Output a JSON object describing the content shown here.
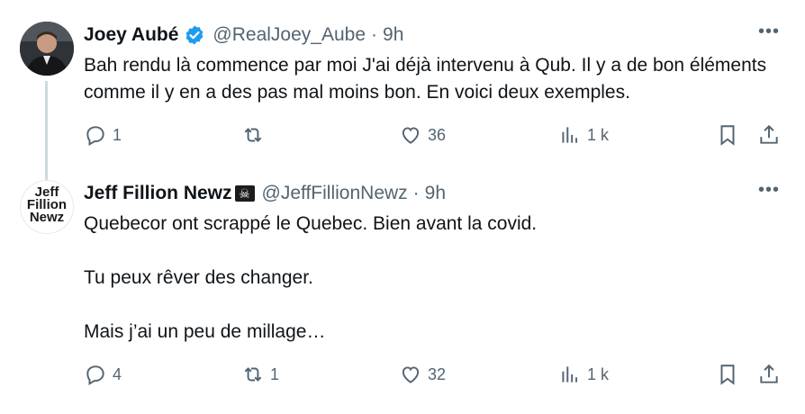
{
  "tweets": [
    {
      "name": "Joey Aubé",
      "handle": "@RealJoey_Aube",
      "time": "9h",
      "text": [
        "Bah rendu là commence par moi J'ai déjà intervenu à Qub. Il y a de bon éléments comme il y en a des pas mal moins bon. En voici deux exemples."
      ],
      "replies": "1",
      "retweets": "",
      "likes": "36",
      "views": "1 k",
      "more": "•••"
    },
    {
      "name": "Jeff Fillion Newz",
      "badge": "☠",
      "handle": "@JeffFillionNewz",
      "time": "9h",
      "avatar_text": [
        "Jeff",
        "Fillion",
        "Newz"
      ],
      "text": [
        "Quebecor ont scrappé le Quebec. Bien avant la covid.",
        "Tu peux rêver des changer.",
        "Mais j’ai un peu de millage…"
      ],
      "replies": "4",
      "retweets": "1",
      "likes": "32",
      "views": "1 k",
      "more": "•••"
    }
  ],
  "colors": {
    "accent": "#1d9bf0",
    "secondary_text": "#536471",
    "thread_line": "#cfd9de"
  }
}
